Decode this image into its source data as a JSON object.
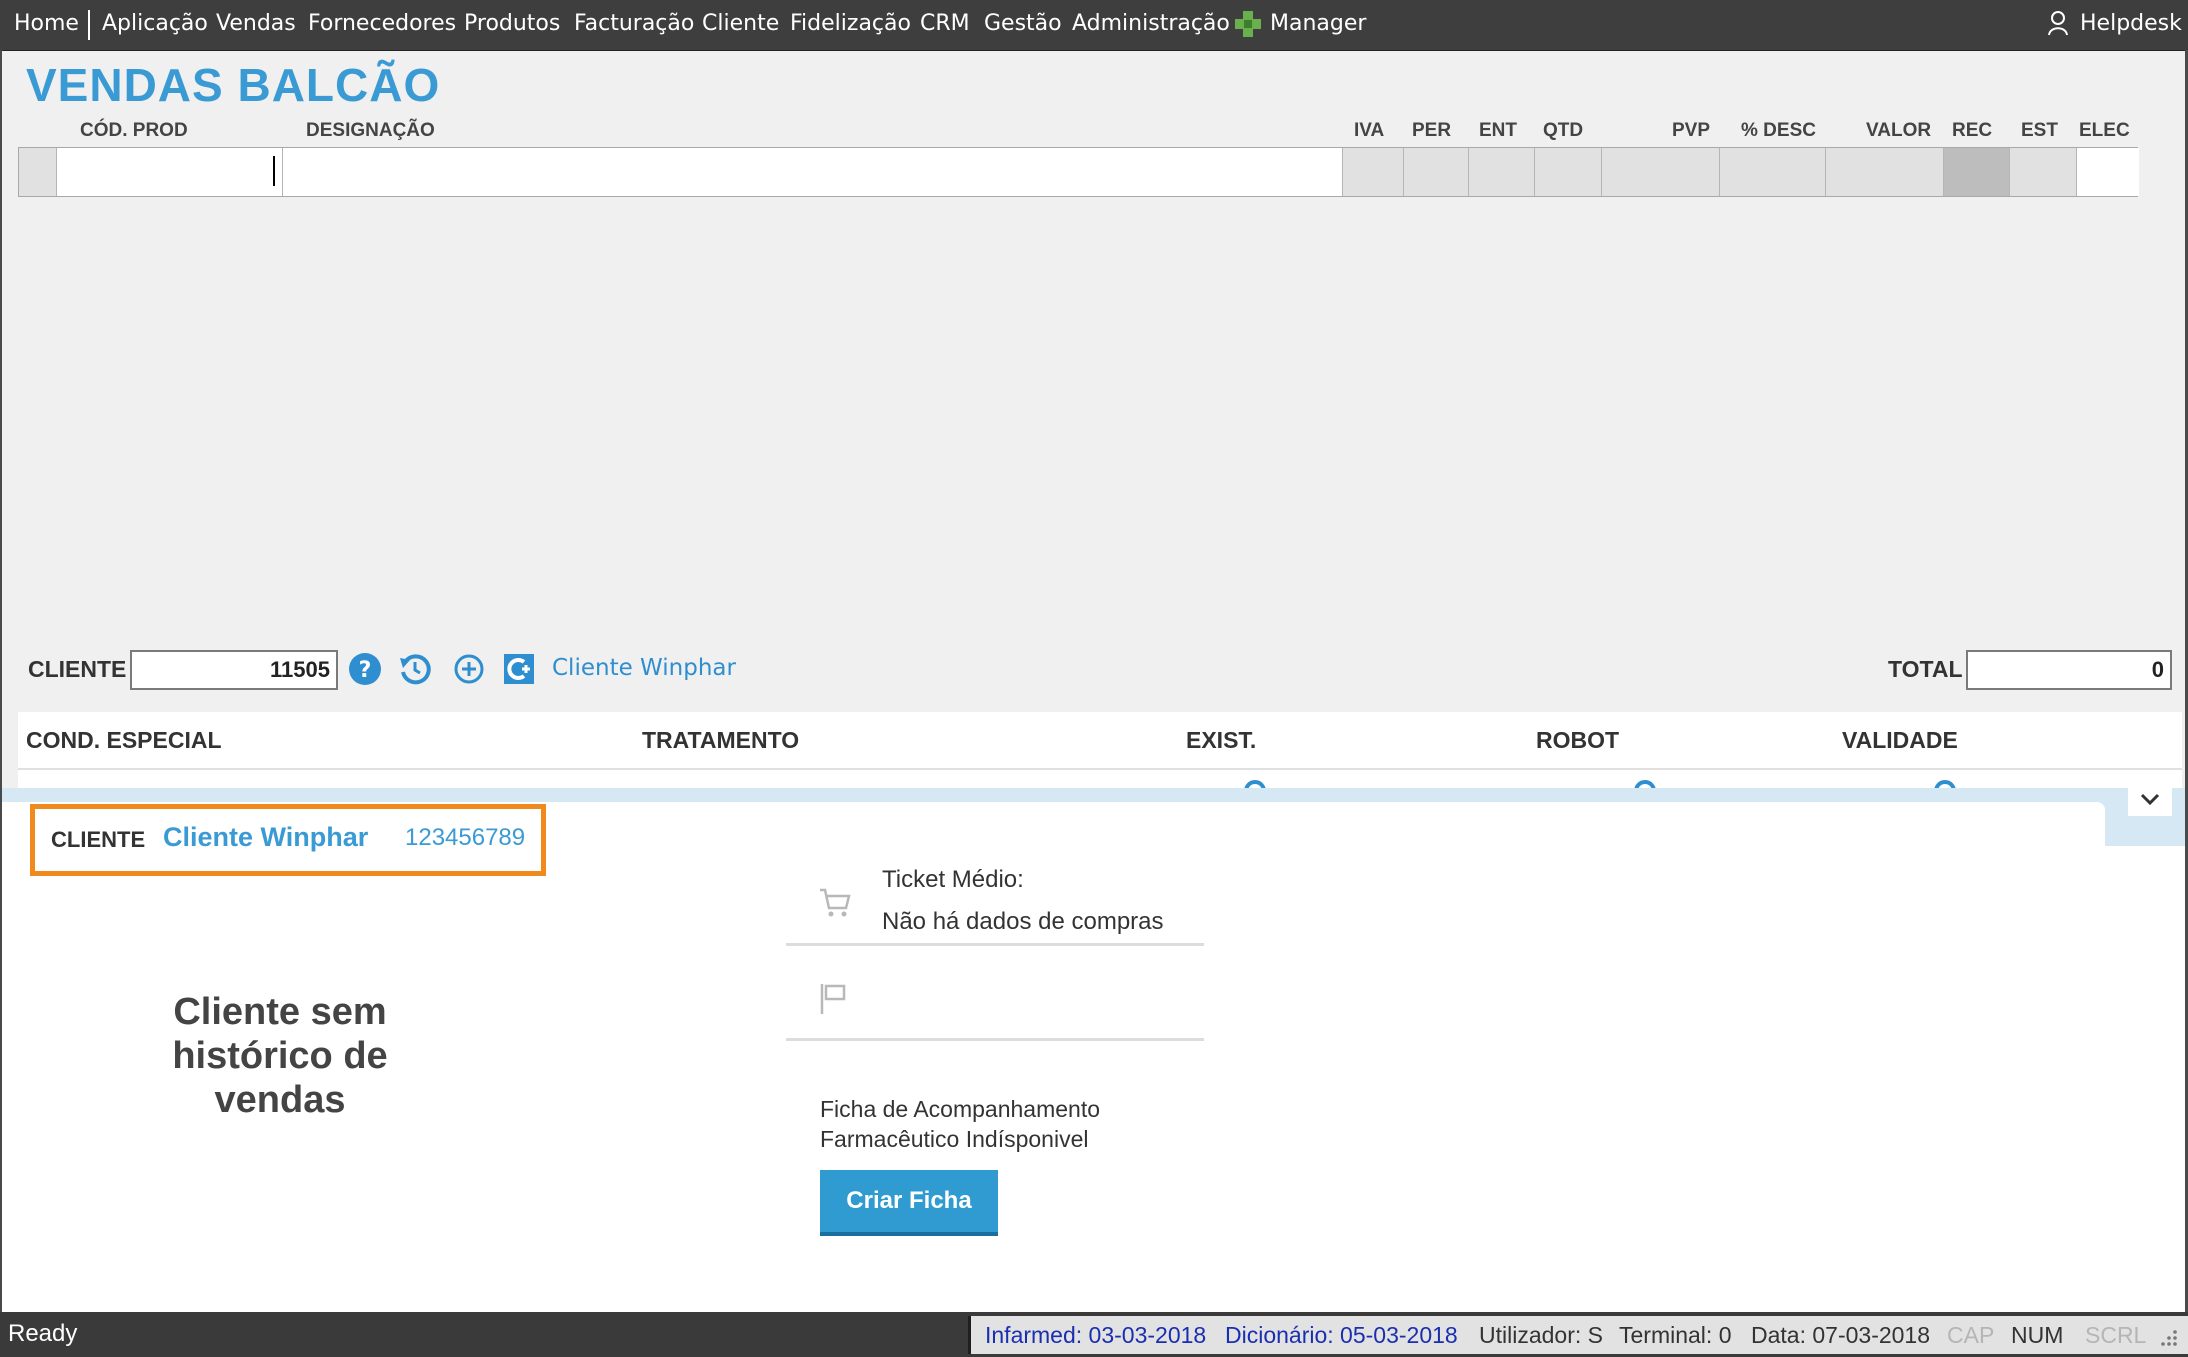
{
  "menu": {
    "home": "Home",
    "items": [
      "Aplicação",
      "Vendas",
      "Fornecedores",
      "Produtos",
      "Facturação",
      "Cliente",
      "Fidelização",
      "CRM",
      "Gestão",
      "Administração",
      "Manager"
    ],
    "helpdesk": "Helpdesk"
  },
  "page": {
    "title": "VENDAS BALCÃO"
  },
  "entry_columns": [
    "CÓD. PROD",
    "DESIGNAÇÃO",
    "IVA",
    "PER",
    "ENT",
    "QTD",
    "PVP",
    "% DESC",
    "VALOR",
    "REC",
    "EST",
    "ELEC"
  ],
  "cliente_bar": {
    "label": "CLIENTE",
    "value": "11505",
    "client_name": "Cliente Winphar",
    "total_label": "TOTAL",
    "total_value": "0"
  },
  "grid": {
    "headers": [
      "COND. ESPECIAL",
      "TRATAMENTO",
      "EXIST.",
      "ROBOT",
      "VALIDADE"
    ]
  },
  "panel": {
    "client_label": "CLIENTE",
    "client_name": "Cliente Winphar",
    "client_nif": "123456789",
    "no_history": "Cliente sem histórico de vendas",
    "ticket_label": "Ticket Médio:",
    "ticket_value": "Não há dados de compras",
    "ficha_line1": "Ficha de Acompanhamento",
    "ficha_line2": "Farmacêutico Indísponivel",
    "criar_button": "Criar Ficha"
  },
  "status": {
    "ready": "Ready",
    "infarmed": "Infarmed: 03-03-2018",
    "dicionario": "Dicionário: 05-03-2018",
    "utilizador": "Utilizador: S",
    "terminal": "Terminal: 0",
    "data": "Data: 07-03-2018",
    "cap": "CAP",
    "num": "NUM",
    "scrl": "SCRL"
  },
  "colors": {
    "accent": "#3a9ad4",
    "menubar": "#3e3e3e",
    "highlight_box": "#f08a1c",
    "button": "#2f9bd0",
    "status_link": "#1a2fb0"
  }
}
